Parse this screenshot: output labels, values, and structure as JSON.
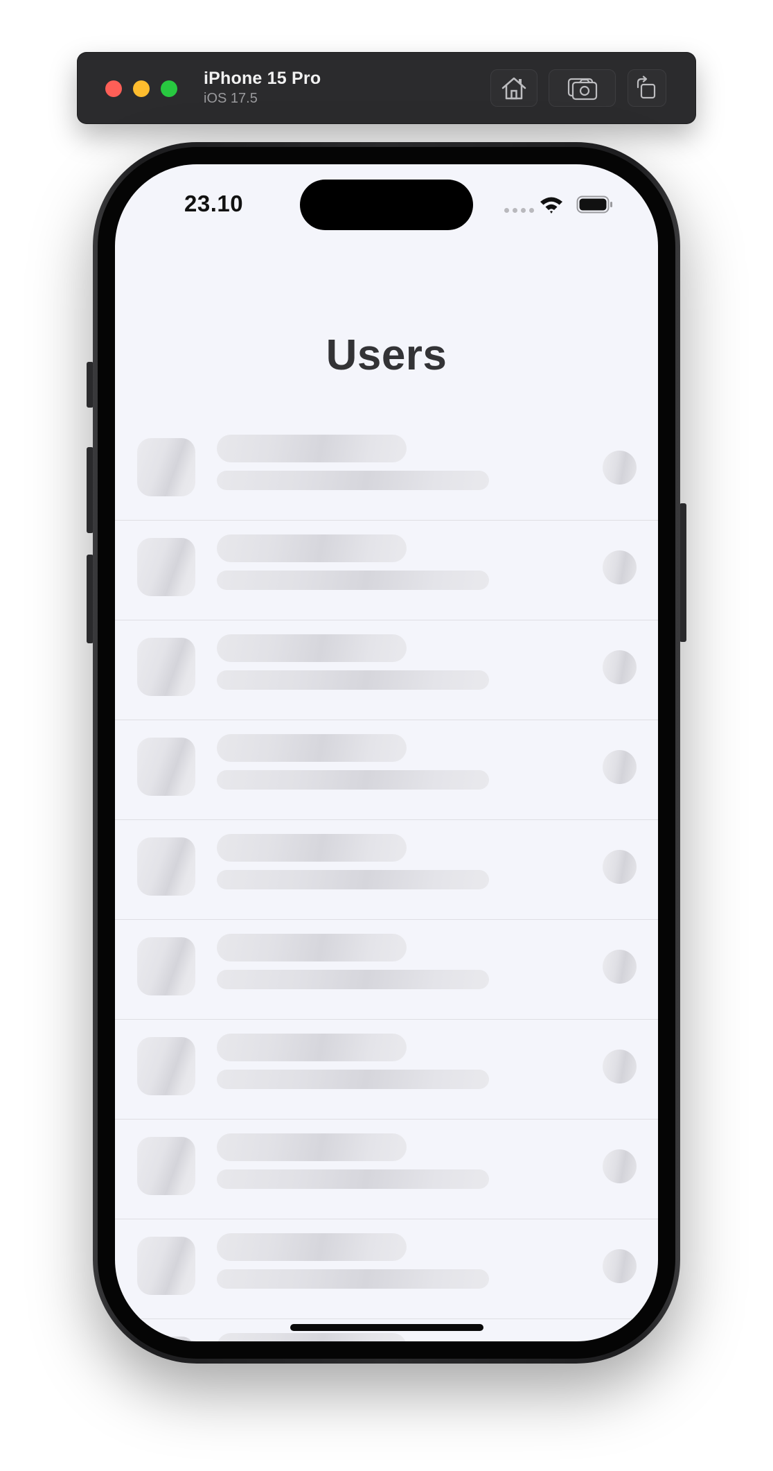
{
  "simulator": {
    "device_name": "iPhone 15 Pro",
    "os_version": "iOS 17.5",
    "buttons": {
      "home_icon": "home-icon",
      "screenshot_icon": "camera-icon",
      "rotate_icon": "rotate-icon"
    },
    "traffic_lights": [
      "#fe5f57",
      "#febc2e",
      "#28c840"
    ]
  },
  "status_bar": {
    "time": "23.10",
    "icons": [
      "cellular-signal-icon",
      "wifi-icon",
      "battery-icon"
    ]
  },
  "page": {
    "title": "Users"
  },
  "user_list": {
    "state": "loading",
    "skeleton_rows": 10
  },
  "colors": {
    "screen_background": "#f4f5fb",
    "title_text": "#333336",
    "skeleton": "#e2e2e7",
    "divider": "#dedee3"
  }
}
